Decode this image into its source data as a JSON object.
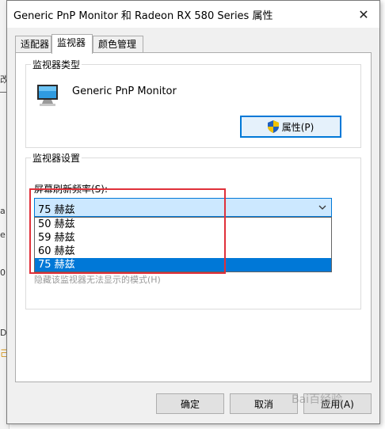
{
  "background": {
    "fragments": [
      "改",
      "a",
      "e",
      "0",
      "D",
      "己",
      "娃"
    ]
  },
  "window": {
    "title": "Generic PnP Monitor 和 Radeon RX 580 Series 属性",
    "close_glyph": "✕"
  },
  "tabs": [
    {
      "label": "适配器",
      "active": false
    },
    {
      "label": "监视器",
      "active": true
    },
    {
      "label": "颜色管理",
      "active": false
    }
  ],
  "monitor_type": {
    "group_title": "监视器类型",
    "monitor_name": "Generic PnP Monitor",
    "properties_button": "属性(P)",
    "icon": "monitor-icon"
  },
  "monitor_settings": {
    "group_title": "监视器设置",
    "refresh_label": "屏幕刷新频率(S):",
    "selected_value": "75 赫兹",
    "options": [
      "50 赫兹",
      "59 赫兹",
      "60 赫兹",
      "75 赫兹"
    ],
    "hint": "隐藏该监视器无法显示的模式(H)"
  },
  "footer": {
    "ok": "确定",
    "cancel": "取消",
    "apply": "应用(A)"
  },
  "watermark": "Bai百经验",
  "colors": {
    "accent": "#0078d7",
    "selection_bg": "#cce8ff",
    "highlight_box": "#e0303a"
  }
}
